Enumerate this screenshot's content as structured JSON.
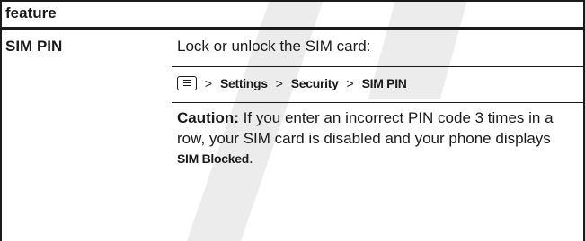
{
  "table": {
    "header": "feature",
    "row": {
      "feature": "SIM PIN",
      "description": "Lock or unlock the SIM card:",
      "path": {
        "icon": "menu-key-icon",
        "separator": ">",
        "steps": [
          "Settings",
          "Security",
          "SIM PIN"
        ]
      },
      "caution": {
        "label": "Caution:",
        "text": " If you enter an incorrect PIN code 3 times in a row, your SIM card is disabled and your phone displays ",
        "blocked_message": "SIM Blocked",
        "end": "."
      }
    }
  },
  "colors": {
    "text": "#1a1a1a",
    "watermark": "#ececec"
  }
}
